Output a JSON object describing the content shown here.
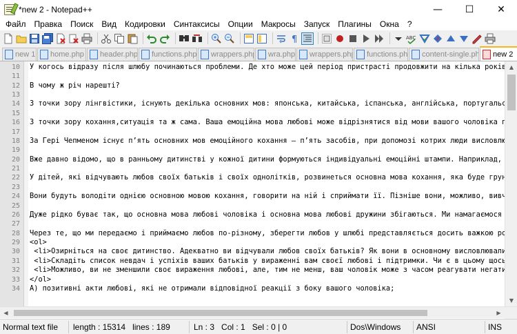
{
  "window": {
    "title": "*new 2 - Notepad++",
    "minimize": "—",
    "maximize": "☐",
    "close": "✕"
  },
  "menu": [
    "Файл",
    "Правка",
    "Поиск",
    "Вид",
    "Кодировки",
    "Синтаксисы",
    "Опции",
    "Макросы",
    "Запуск",
    "Плагины",
    "Окна",
    "?"
  ],
  "toolbar": {
    "icons": [
      "new-file-icon",
      "open-file-icon",
      "save-icon",
      "save-all-icon",
      "close-icon",
      "close-all-icon",
      "print-icon",
      "cut-icon",
      "copy-icon",
      "paste-icon",
      "undo-icon",
      "redo-icon",
      "find-icon",
      "replace-icon",
      "zoom-in-icon",
      "zoom-out-icon",
      "sync-vertical-icon",
      "sync-horizontal-icon",
      "word-wrap-icon",
      "show-all-chars-icon",
      "indent-guide-icon",
      "record-macro-icon",
      "stop-record-icon",
      "play-macro-icon",
      "play-multiple-icon",
      "save-macro-icon",
      "spell-check-icon",
      "spell-next-icon",
      "spell-prev-icon",
      "up-icon",
      "down-icon",
      "highlight-icon",
      "print-icon-2",
      "extra-icon"
    ]
  },
  "tabs": [
    {
      "label": "new 1",
      "active": false,
      "icon": "blue"
    },
    {
      "label": "home.php",
      "active": false,
      "icon": "blue"
    },
    {
      "label": "header.php",
      "active": false,
      "icon": "blue"
    },
    {
      "label": "functions.php",
      "active": false,
      "icon": "blue"
    },
    {
      "label": "wrappers.php",
      "active": false,
      "icon": "blue"
    },
    {
      "label": "wra.php",
      "active": false,
      "icon": "blue"
    },
    {
      "label": "wrappers.php",
      "active": false,
      "icon": "blue"
    },
    {
      "label": "functions.php",
      "active": false,
      "icon": "blue"
    },
    {
      "label": "content-single.php",
      "active": false,
      "icon": "blue"
    },
    {
      "label": "new 2",
      "active": true,
      "icon": "red"
    }
  ],
  "editor": {
    "lines": [
      {
        "n": "10",
        "text": "У когось відразу після шлюбу починаються проблеми. Де хто може цей період пристрасті продовжити на кілька років, а"
      },
      {
        "n": "11",
        "text": ""
      },
      {
        "n": "12",
        "text": "В чому ж річ нарешті?"
      },
      {
        "n": "13",
        "text": ""
      },
      {
        "n": "14",
        "text": "З точки зору лінгвістики, існують декілька основних мов: японська, китайська, іспанська, англійська, португальська"
      },
      {
        "n": "15",
        "text": ""
      },
      {
        "n": "16",
        "text": "З точки зору кохання,ситуація та ж сама. Ваша емоційна мова любові може відрізнятися від мови вашого чоловіка по"
      },
      {
        "n": "17",
        "text": ""
      },
      {
        "n": "18",
        "text": "За Гері Чепменом існує п’ять основних мов емоційного кохання – п’ять засобів, при допомозі котрих люди висловлюют"
      },
      {
        "n": "19",
        "text": ""
      },
      {
        "n": "20",
        "text": "Вже давно відомо, що в ранньому дитинстві у кожної дитини формуються індивідуальні емоційні штампи. Наприклад, у"
      },
      {
        "n": "21",
        "text": ""
      },
      {
        "n": "22",
        "text": "У дітей, які відчувають любов своїх батьків і своїх однолітків, розвинеться основна мова кохання, яка буде грунту"
      },
      {
        "n": "23",
        "text": ""
      },
      {
        "n": "24",
        "text": "Вони будуть володіти однією основною мовою кохання, говорити на ній і сприймати її. Пізніше вони, можливо, вивчат"
      },
      {
        "n": "25",
        "text": ""
      },
      {
        "n": "26",
        "text": "Дуже рідко буває так, що основна мова любові чоловіка і основна мова любові дружини збігаються. Ми намагаємося гр"
      },
      {
        "n": "27",
        "text": ""
      },
      {
        "n": "28",
        "text": "Через те, що ми передаємо і приймаємо любов по-різному, зберегти любов у шлюбі представляється досить важкою роб"
      },
      {
        "n": "29",
        "text": "<ol>"
      },
      {
        "n": "30",
        "text": " <li>Озирніться на своє дитинство. Адекватно ви відчували любов своїх батьків? Як вони в основному висловлювали"
      },
      {
        "n": "31",
        "text": " <li>Складіть список невдач і успіхів ваших батьків у вираженні вам своєї любові і підтримки. Чи є в цьому щось"
      },
      {
        "n": "32",
        "text": " <li>Можливо, ви не зменшили своє вираження любові, але, тим не менш, ваш чоловік може з часом реагувати негатив"
      },
      {
        "n": "33",
        "text": "</ol>"
      },
      {
        "n": "34",
        "text": "А) позитивні акти любові, які не отримали відповідної реакції з боку вашого чоловіка;"
      }
    ]
  },
  "status": {
    "type": "Normal text file",
    "length": "length : 15314",
    "lines": "lines : 189",
    "ln": "Ln : 3",
    "col": "Col : 1",
    "sel": "Sel : 0 | 0",
    "eol": "Dos\\Windows",
    "encoding": "ANSI",
    "mode": "INS"
  }
}
